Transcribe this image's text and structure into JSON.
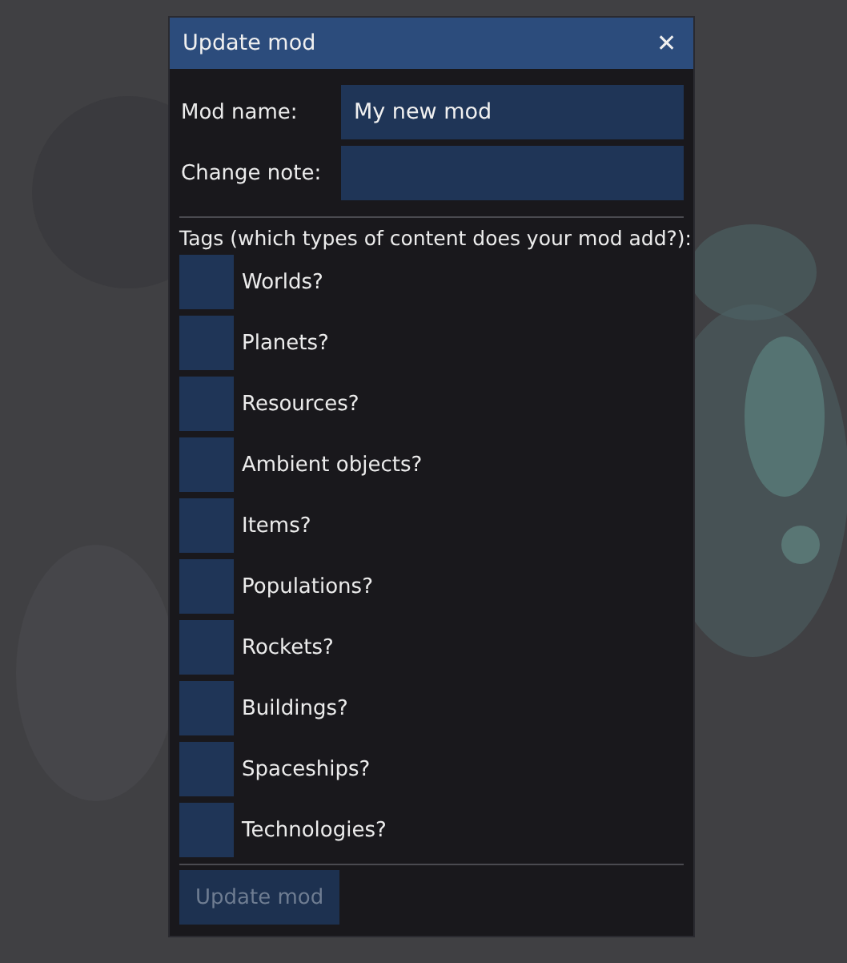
{
  "dialog": {
    "title": "Update mod",
    "close": "✕"
  },
  "fields": [
    {
      "label": "Mod name:",
      "value": "My new mod"
    },
    {
      "label": "Change note:"
    }
  ],
  "tags_label": "Tags (which types of content does your mod add?):",
  "tags": [
    {
      "label": "Worlds?",
      "checked": false
    },
    {
      "label": "Planets?",
      "checked": false
    },
    {
      "label": "Resources?",
      "checked": false
    },
    {
      "label": "Ambient objects?",
      "checked": false
    },
    {
      "label": "Items?",
      "checked": false
    },
    {
      "label": "Populations?",
      "checked": false
    },
    {
      "label": "Rockets?",
      "checked": false
    },
    {
      "label": "Buildings?",
      "checked": false
    },
    {
      "label": "Spaceships?",
      "checked": false
    },
    {
      "label": "Technologies?",
      "checked": false
    }
  ],
  "button": {
    "label": "Update mod",
    "disabled": true
  }
}
